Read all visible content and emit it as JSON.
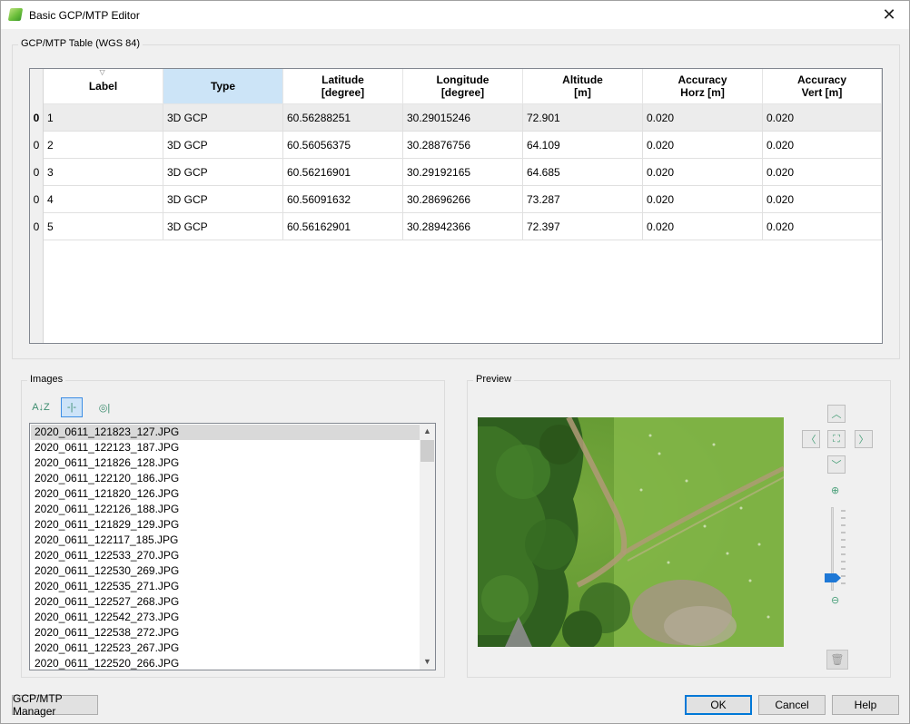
{
  "window": {
    "title": "Basic GCP/MTP Editor",
    "close_glyph": "✕"
  },
  "table_group": {
    "label": "GCP/MTP Table (WGS 84)",
    "columns": [
      "Label",
      "Type",
      "Latitude\n[degree]",
      "Longitude\n[degree]",
      "Altitude\n[m]",
      "Accuracy\nHorz [m]",
      "Accuracy\nVert [m]"
    ],
    "row_headers": [
      "0",
      "0",
      "0",
      "0",
      "0"
    ],
    "rows": [
      [
        "1",
        "3D GCP",
        "60.56288251",
        "30.29015246",
        "72.901",
        "0.020",
        "0.020"
      ],
      [
        "2",
        "3D GCP",
        "60.56056375",
        "30.28876756",
        "64.109",
        "0.020",
        "0.020"
      ],
      [
        "3",
        "3D GCP",
        "60.56216901",
        "30.29192165",
        "64.685",
        "0.020",
        "0.020"
      ],
      [
        "4",
        "3D GCP",
        "60.56091632",
        "30.28696266",
        "73.287",
        "0.020",
        "0.020"
      ],
      [
        "5",
        "3D GCP",
        "60.56162901",
        "30.28942366",
        "72.397",
        "0.020",
        "0.020"
      ]
    ]
  },
  "images_group": {
    "label": "Images",
    "toolbar": [
      {
        "icon": "sort-az-icon",
        "glyph": "A↓Z"
      },
      {
        "icon": "filter-gcp-icon",
        "glyph": "-|-",
        "active": true
      },
      {
        "icon": "show-marked-icon",
        "glyph": "◎|"
      }
    ],
    "files": [
      "2020_0611_121823_127.JPG",
      "2020_0611_122123_187.JPG",
      "2020_0611_121826_128.JPG",
      "2020_0611_122120_186.JPG",
      "2020_0611_121820_126.JPG",
      "2020_0611_122126_188.JPG",
      "2020_0611_121829_129.JPG",
      "2020_0611_122117_185.JPG",
      "2020_0611_122533_270.JPG",
      "2020_0611_122530_269.JPG",
      "2020_0611_122535_271.JPG",
      "2020_0611_122527_268.JPG",
      "2020_0611_122542_273.JPG",
      "2020_0611_122538_272.JPG",
      "2020_0611_122523_267.JPG",
      "2020_0611_122520_266.JPG"
    ],
    "selected_index": 0
  },
  "preview_group": {
    "label": "Preview"
  },
  "buttons": {
    "manager": "GCP/MTP Manager",
    "ok": "OK",
    "cancel": "Cancel",
    "help": "Help"
  },
  "colors": {
    "accent": "#0078d7",
    "header_selected": "#cce4f7",
    "icon_green": "#4aa07a"
  }
}
